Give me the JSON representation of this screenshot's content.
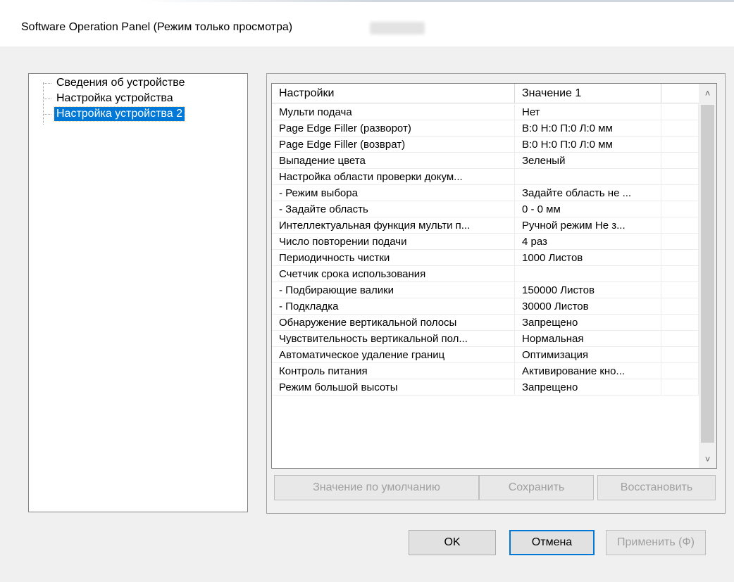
{
  "window": {
    "title": "Software Operation Panel (Режим только просмотра)"
  },
  "tree": {
    "items": [
      {
        "label": "Сведения об устройстве",
        "selected": false
      },
      {
        "label": "Настройка устройства",
        "selected": false
      },
      {
        "label": "Настройка устройства 2",
        "selected": true
      }
    ]
  },
  "list": {
    "columns": [
      "Настройки",
      "Значение 1",
      ""
    ],
    "rows": [
      [
        "Мульти подача",
        "Нет"
      ],
      [
        "Page Edge Filler (разворот)",
        "В:0  Н:0  П:0  Л:0 мм"
      ],
      [
        "Page Edge Filler (возврат)",
        "В:0  Н:0  П:0  Л:0 мм"
      ],
      [
        "Выпадение цвета",
        "Зеленый"
      ],
      [
        "Настройка области проверки докум...",
        ""
      ],
      [
        " - Режим выбора",
        "Задайте область не ..."
      ],
      [
        " - Задайте область",
        "0 - 0 мм"
      ],
      [
        "Интеллектуальная функция мульти п...",
        "Ручной режим  Не з..."
      ],
      [
        "Число повторении подачи",
        "4 раз"
      ],
      [
        "Периодичность чистки",
        "1000 Листов"
      ],
      [
        "Счетчик срока использования",
        ""
      ],
      [
        " - Подбирающие валики",
        "150000 Листов"
      ],
      [
        " - Подкладка",
        "30000 Листов"
      ],
      [
        "Обнаружение вертикальной полосы",
        "Запрещено"
      ],
      [
        "Чувствительность вертикальной пол...",
        "Нормальная"
      ],
      [
        "Автоматическое удаление границ",
        "Оптимизация"
      ],
      [
        "Контроль питания",
        "Активирование кно..."
      ],
      [
        "Режим большой высоты",
        "Запрещено"
      ]
    ],
    "scroll_up_icon": "chevron-up-icon",
    "scroll_down_icon": "chevron-down-icon"
  },
  "panel_buttons": {
    "default_label": "Значение по умолчанию",
    "save_label": "Сохранить",
    "restore_label": "Восстановить"
  },
  "dialog_buttons": {
    "ok_label": "OK",
    "cancel_label": "Отмена",
    "apply_label": "Применить (Ф)"
  },
  "colors": {
    "selection": "#0078d7",
    "disabled_text": "#a0a0a0",
    "client_bg": "#f0f0f0"
  }
}
